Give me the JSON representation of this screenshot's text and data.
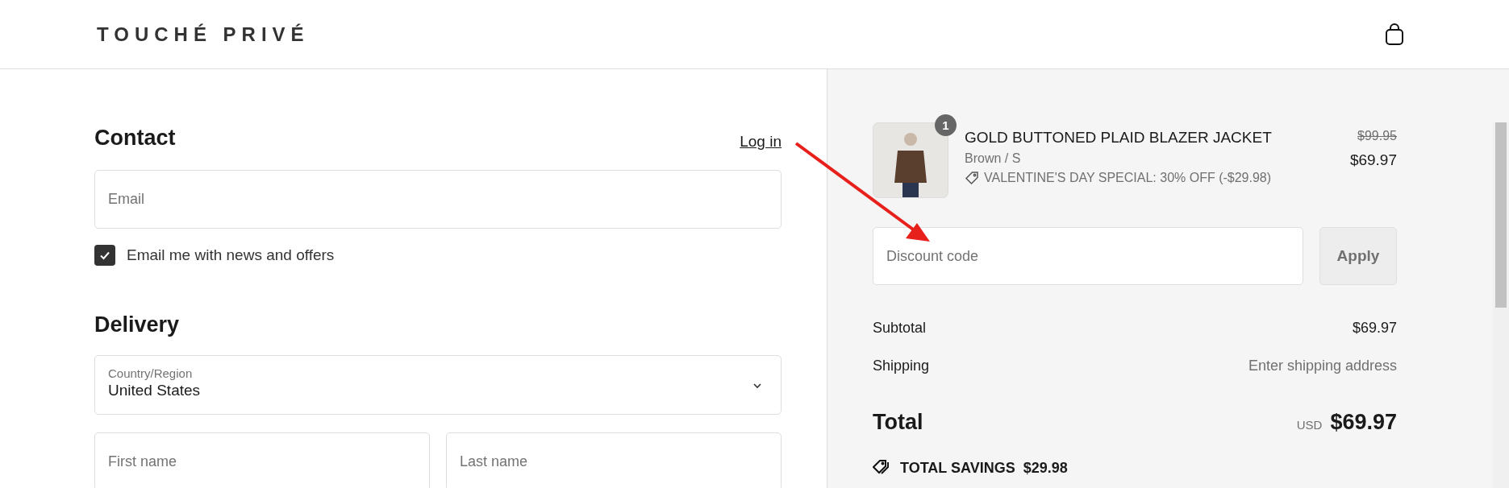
{
  "header": {
    "logo": "TOUCHÉ PRIVÉ"
  },
  "contact": {
    "title": "Contact",
    "login_link": "Log in",
    "email": {
      "placeholder": "Email"
    },
    "newsletter": {
      "label": "Email me with news and offers",
      "checked": true
    }
  },
  "delivery": {
    "title": "Delivery",
    "country": {
      "label": "Country/Region",
      "value": "United States"
    },
    "first_name": {
      "placeholder": "First name"
    },
    "last_name": {
      "placeholder": "Last name"
    }
  },
  "summary": {
    "items": [
      {
        "quantity": "1",
        "name": "GOLD BUTTONED PLAID BLAZER JACKET",
        "variant": "Brown / S",
        "discount": "VALENTINE'S DAY SPECIAL: 30% OFF (-$29.98)",
        "original_price": "$99.95",
        "price": "$69.97"
      }
    ],
    "discount_code": {
      "placeholder": "Discount code"
    },
    "apply_button": "Apply",
    "lines": [
      {
        "label": "Subtotal",
        "value": "$69.97",
        "kind": "amount"
      },
      {
        "label": "Shipping",
        "value": "Enter shipping address",
        "kind": "note"
      }
    ],
    "total": {
      "label": "Total",
      "currency": "USD",
      "value": "$69.97"
    },
    "savings": {
      "label": "TOTAL SAVINGS",
      "value": "$29.98"
    }
  }
}
